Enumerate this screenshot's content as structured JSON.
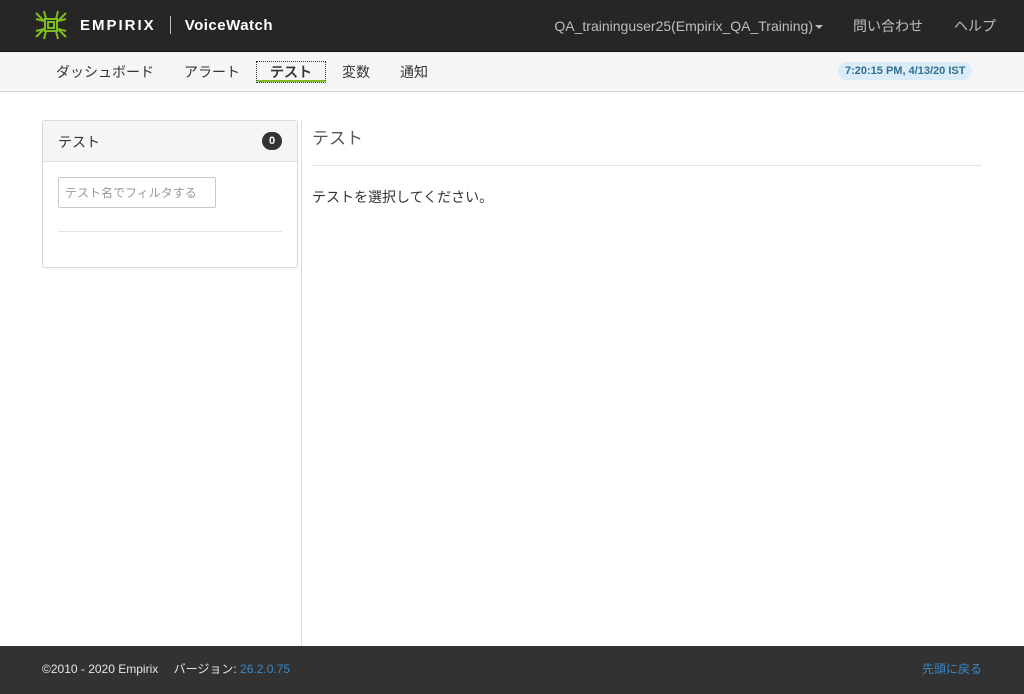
{
  "header": {
    "brand": "EMPIRIX",
    "product": "VoiceWatch",
    "user": "QA_traininguser25(Empirix_QA_Training)",
    "contact": "問い合わせ",
    "help": "ヘルプ"
  },
  "nav": {
    "tabs": [
      "ダッシュボード",
      "アラート",
      "テスト",
      "変数",
      "通知"
    ],
    "active_tab": "テスト",
    "clock": "7:20:15 PM, 4/13/20 IST"
  },
  "sidebar": {
    "title": "テスト",
    "count": "0",
    "filter_placeholder": "テスト名でフィルタする",
    "filter_value": ""
  },
  "main": {
    "title": "テスト",
    "message": "テストを選択してください。"
  },
  "footer": {
    "copyright": "©2010 - 2020 Empirix",
    "version_label": "バージョン:",
    "version": "26.2.0.75",
    "back_to_top": "先頭に戻る"
  },
  "colors": {
    "topbar": "#262626",
    "accent_green": "#7ebd1c",
    "link_blue": "#3a87c7"
  }
}
